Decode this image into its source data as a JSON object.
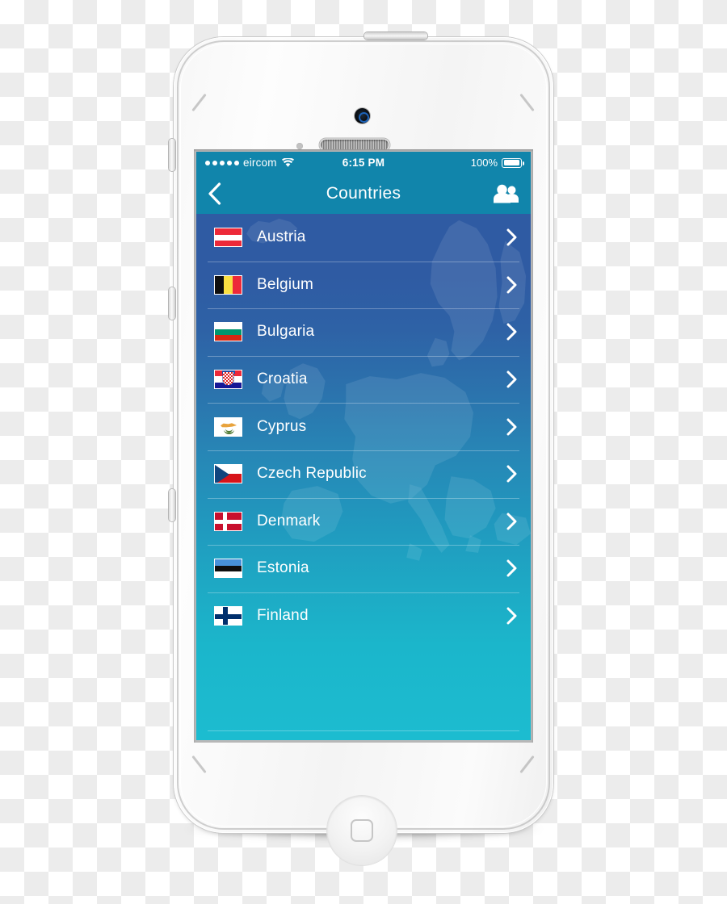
{
  "status_bar": {
    "signal_dots": 5,
    "carrier": "eircom",
    "wifi_icon": "wifi-icon",
    "time": "6:15 PM",
    "battery_percent": "100%",
    "battery_icon": "battery-full-icon"
  },
  "nav_bar": {
    "back_icon": "chevron-left-icon",
    "title": "Countries",
    "people_icon": "people-icon"
  },
  "theme": {
    "nav_color": "#1185ab",
    "gradient_top": "#2f5ba3",
    "gradient_bottom": "#1cbcd0",
    "text_color": "#ffffff",
    "separator_color": "rgba(255,255,255,0.30)"
  },
  "list": {
    "chevron_icon": "chevron-right-icon",
    "items": [
      {
        "name": "Austria",
        "flag": "flag-austria"
      },
      {
        "name": "Belgium",
        "flag": "flag-belgium"
      },
      {
        "name": "Bulgaria",
        "flag": "flag-bulgaria"
      },
      {
        "name": "Croatia",
        "flag": "flag-croatia"
      },
      {
        "name": "Cyprus",
        "flag": "flag-cyprus"
      },
      {
        "name": "Czech Republic",
        "flag": "flag-czech-republic"
      },
      {
        "name": "Denmark",
        "flag": "flag-denmark"
      },
      {
        "name": "Estonia",
        "flag": "flag-estonia"
      },
      {
        "name": "Finland",
        "flag": "flag-finland"
      }
    ]
  },
  "device": {
    "type": "white-smartphone",
    "camera_icon": "front-camera",
    "speaker_icon": "earpiece-speaker",
    "sensor_icon": "proximity-sensor",
    "home_button_icon": "home-button",
    "power_button_icon": "power-button",
    "mute_switch_icon": "mute-switch",
    "volume_up_icon": "volume-up-button",
    "volume_down_icon": "volume-down-button"
  }
}
